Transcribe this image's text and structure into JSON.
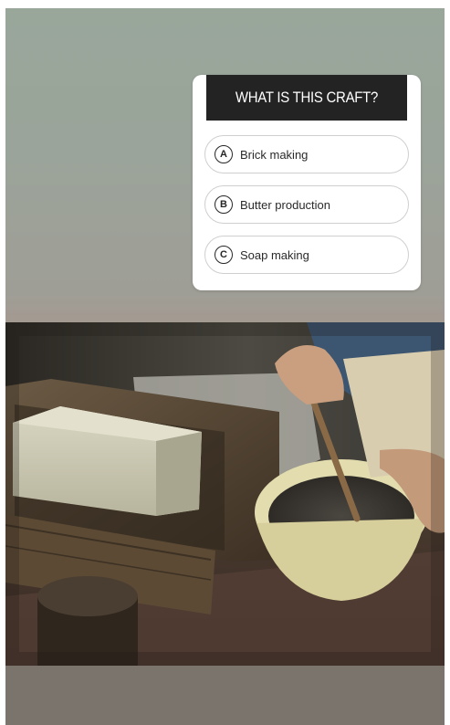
{
  "quiz": {
    "question": "WHAT IS THIS CRAFT?",
    "options": [
      {
        "letter": "A",
        "text": "Brick making"
      },
      {
        "letter": "B",
        "text": "Butter production"
      },
      {
        "letter": "C",
        "text": "Soap making"
      }
    ]
  },
  "colors": {
    "header_bg": "#232323",
    "card_bg": "#ffffff",
    "background_top": "#99a79b",
    "background_bottom": "#7b746c"
  },
  "photo": {
    "subject_icon": "soap-making-photo"
  }
}
